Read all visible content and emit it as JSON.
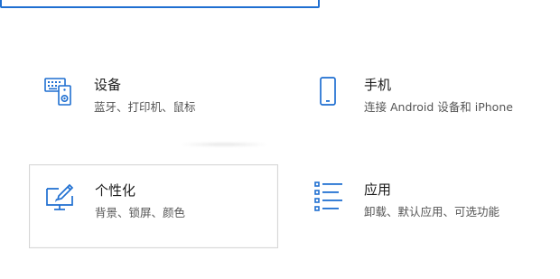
{
  "accent_color": "#1f6fd1",
  "tiles": [
    {
      "id": "devices",
      "icon": "keyboard-speaker-icon",
      "title": "设备",
      "desc": "蓝牙、打印机、鼠标"
    },
    {
      "id": "phone",
      "icon": "phone-icon",
      "title": "手机",
      "desc": "连接 Android 设备和 iPhone"
    },
    {
      "id": "personalization",
      "icon": "paintbrush-monitor-icon",
      "title": "个性化",
      "desc": "背景、锁屏、颜色"
    },
    {
      "id": "apps",
      "icon": "app-list-icon",
      "title": "应用",
      "desc": "卸载、默认应用、可选功能"
    }
  ]
}
